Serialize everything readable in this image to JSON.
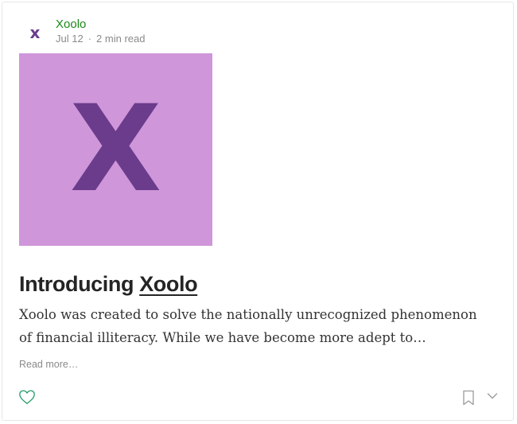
{
  "post": {
    "author": "Xoolo",
    "date": "Jul 12",
    "read_time": "2 min read",
    "avatar_letter": "x",
    "hero_letter": "X",
    "title_prefix": "Introducing ",
    "title_link": "Xoolo",
    "excerpt": "Xoolo was created to solve the nationally unrecognized phenomenon of financial illiteracy. While we have become more adept to…",
    "read_more": "Read more…"
  },
  "colors": {
    "brand_purple": "#6b3c8c",
    "hero_bg": "#cf96da",
    "author_green": "#1a8917",
    "heart_outline": "#1c9963",
    "icon_gray": "#9b9b9b"
  },
  "icons": {
    "like": "heart-icon",
    "save": "bookmark-icon",
    "more": "chevron-down-icon"
  }
}
